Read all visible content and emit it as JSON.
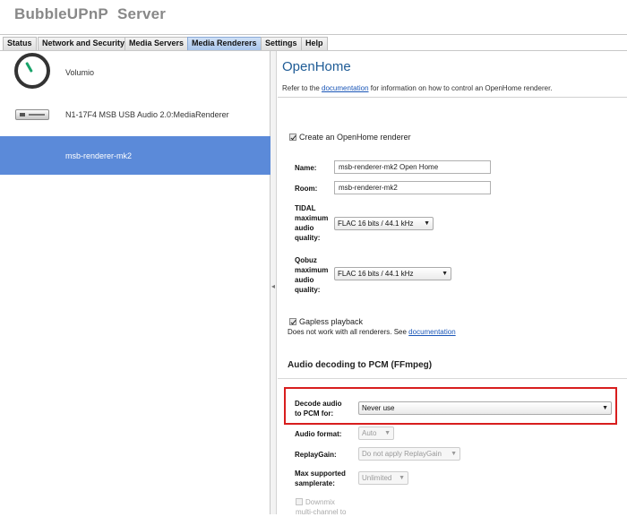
{
  "app": {
    "title": "BubbleUPnP",
    "subtitle": "Server"
  },
  "tabs": [
    {
      "label": "Status"
    },
    {
      "label": "Network and Security"
    },
    {
      "label": "Media Servers"
    },
    {
      "label": "Media Renderers",
      "active": true
    },
    {
      "label": "Settings"
    },
    {
      "label": "Help"
    }
  ],
  "renderers": [
    {
      "name": "Volumio",
      "icon": "volume-knob-icon"
    },
    {
      "name": "N1-17F4 MSB USB Audio 2.0:MediaRenderer",
      "icon": "audio-device-icon"
    },
    {
      "name": "msb-renderer-mk2",
      "selected": true
    }
  ],
  "openhome": {
    "title": "OpenHome",
    "desc_before": "Refer to the ",
    "desc_link": "documentation",
    "desc_after": " for information on how to control an OpenHome renderer.",
    "create_label": "Create an OpenHome renderer",
    "create_checked": true,
    "name_label": "Name:",
    "name_value": "msb-renderer-mk2 Open Home",
    "room_label": "Room:",
    "room_value": "msb-renderer-mk2",
    "tidal_label": [
      "TIDAL",
      "maximum",
      "audio",
      "quality:"
    ],
    "tidal_value": "FLAC 16 bits / 44.1 kHz",
    "qobuz_label": [
      "Qobuz",
      "maximum",
      "audio",
      "quality:"
    ],
    "qobuz_value": "FLAC 16 bits / 44.1 kHz",
    "gapless_label": "Gapless playback",
    "gapless_checked": true,
    "gapless_note_before": "Does not work with all renderers. See ",
    "gapless_note_link": "documentation"
  },
  "decoding": {
    "title": "Audio decoding to PCM (FFmpeg)",
    "decode_label": [
      "Decode audio",
      "to PCM for:"
    ],
    "decode_value": "Never use",
    "format_label": "Audio format:",
    "format_value": "Auto",
    "replaygain_label": "ReplayGain:",
    "replaygain_value": "Do not apply ReplayGain",
    "samplerate_label": [
      "Max supported",
      "samplerate:"
    ],
    "samplerate_value": "Unlimited",
    "downmix_label": [
      "Downmix",
      "multi-channel to"
    ]
  },
  "colors": {
    "accent": "#5b8ad9",
    "title": "#1f5c96",
    "highlight": "#d81e1e"
  }
}
